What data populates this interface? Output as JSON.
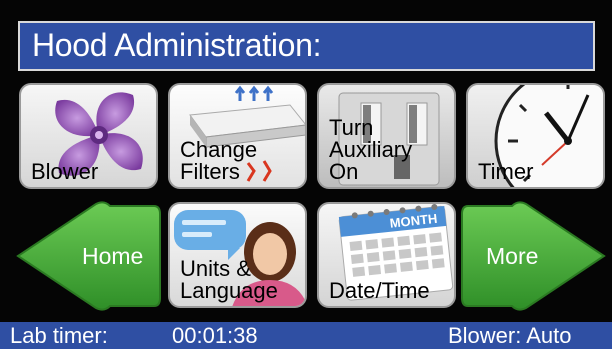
{
  "header": {
    "title": "Hood Administration:"
  },
  "tiles": [
    {
      "label": "Blower",
      "icon": "fan-icon"
    },
    {
      "label": "Change\nFilters",
      "icon": "filter-icon"
    },
    {
      "label": "Turn\nAuxiliary\nOn",
      "icon": "outlet-icon"
    },
    {
      "label": "Timer",
      "icon": "clock-icon"
    },
    {
      "label": "Units &\nLanguage",
      "icon": "person-speech-icon"
    },
    {
      "label": "Date/Time",
      "icon": "calendar-icon"
    }
  ],
  "calendar_month": "MONTH",
  "nav": {
    "home": "Home",
    "more": "More"
  },
  "status": {
    "lab_timer_label": "Lab timer:",
    "lab_timer_value": "00:01:38",
    "blower": "Blower: Auto"
  },
  "colors": {
    "title_bg": "#2f4fa3",
    "arrow_green": "#49ae3c",
    "fan_purple": "#8e4bb0"
  }
}
